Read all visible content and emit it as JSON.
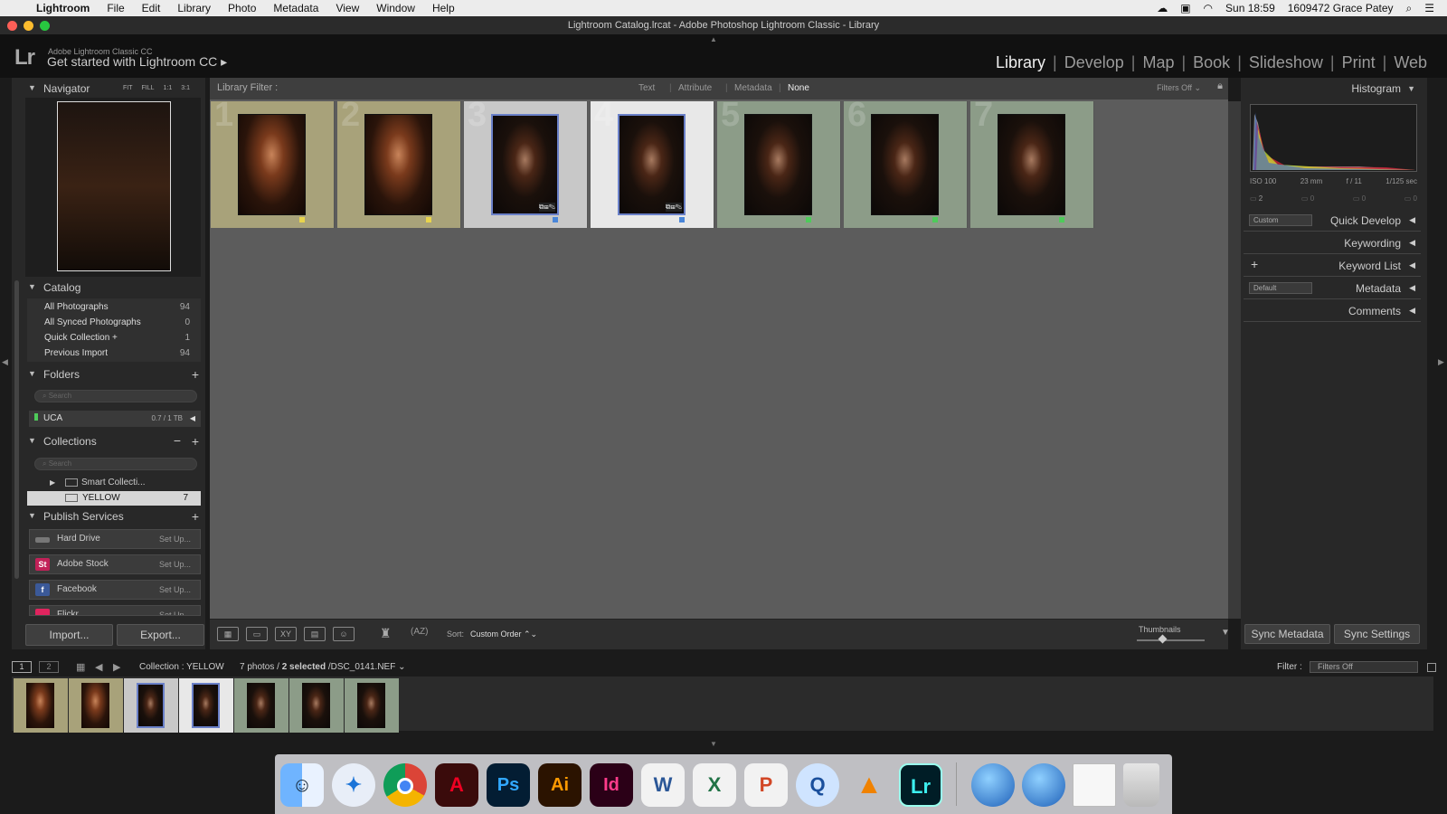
{
  "menubar": {
    "app": "Lightroom",
    "items": [
      "File",
      "Edit",
      "Library",
      "Photo",
      "Metadata",
      "View",
      "Window",
      "Help"
    ],
    "clock": "Sun 18:59",
    "user": "1609472 Grace Patey"
  },
  "window": {
    "title": "Lightroom Catalog.lrcat - Adobe Photoshop Lightroom Classic - Library"
  },
  "identity": {
    "logo": "Lr",
    "small": "Adobe Lightroom Classic CC",
    "big": "Get started with Lightroom CC"
  },
  "modules": [
    "Library",
    "Develop",
    "Map",
    "Book",
    "Slideshow",
    "Print",
    "Web"
  ],
  "navigator": {
    "title": "Navigator",
    "zoom": [
      "FIT",
      "FILL",
      "1:1",
      "3:1"
    ]
  },
  "catalog": {
    "title": "Catalog",
    "rows": [
      {
        "label": "All Photographs",
        "count": "94"
      },
      {
        "label": "All Synced Photographs",
        "count": "0"
      },
      {
        "label": "Quick Collection +",
        "count": "1"
      },
      {
        "label": "Previous Import",
        "count": "94"
      }
    ]
  },
  "folders": {
    "title": "Folders",
    "search": "Search",
    "volume": "UCA",
    "volume_size": "0.7 / 1 TB"
  },
  "collections": {
    "title": "Collections",
    "search": "Search",
    "smart": "Smart Collecti...",
    "yellow": "YELLOW",
    "yellow_count": "7"
  },
  "publish": {
    "title": "Publish Services",
    "rows": [
      {
        "label": "Hard Drive",
        "setup": "Set Up..."
      },
      {
        "label": "Adobe Stock",
        "setup": "Set Up..."
      },
      {
        "label": "Facebook",
        "setup": "Set Up..."
      },
      {
        "label": "Flickr",
        "setup": "Set Up..."
      }
    ]
  },
  "left_buttons": {
    "import": "Import...",
    "export": "Export..."
  },
  "filter": {
    "label": "Library Filter :",
    "tabs": [
      "Text",
      "Attribute",
      "Metadata",
      "None"
    ],
    "state": "Filters Off"
  },
  "grid": {
    "cells": [
      {
        "num": "1",
        "label_color": "#e8d44d",
        "bg": "#a8a27a",
        "selected": false
      },
      {
        "num": "2",
        "label_color": "#e8d44d",
        "bg": "#a8a27a",
        "selected": false
      },
      {
        "num": "3",
        "label_color": "#4a86d9",
        "bg": "#c8c8c8",
        "selected": true
      },
      {
        "num": "4",
        "label_color": "#4a86d9",
        "bg": "#e8e8e8",
        "selected": true
      },
      {
        "num": "5",
        "label_color": "#4ecb5a",
        "bg": "#8c9c88",
        "selected": false
      },
      {
        "num": "6",
        "label_color": "#4ecb5a",
        "bg": "#8c9c88",
        "selected": false
      },
      {
        "num": "7",
        "label_color": "#4ecb5a",
        "bg": "#8c9c88",
        "selected": false
      }
    ]
  },
  "toolbar": {
    "sort_label": "Sort:",
    "sort_value": "Custom Order",
    "thumbnails": "Thumbnails"
  },
  "histogram": {
    "title": "Histogram",
    "iso": "ISO 100",
    "focal": "23 mm",
    "aperture": "f / 11",
    "shutter": "1/125 sec",
    "count": "2"
  },
  "right_panels": {
    "quick_develop": "Quick Develop",
    "quick_develop_preset": "Custom",
    "keywording": "Keywording",
    "keyword_list": "Keyword List",
    "metadata": "Metadata",
    "metadata_preset": "Default",
    "comments": "Comments"
  },
  "right_buttons": {
    "sync_metadata": "Sync Metadata",
    "sync_settings": "Sync Settings"
  },
  "filmstrip": {
    "page1": "1",
    "page2": "2",
    "source": "Collection : YELLOW",
    "count_pre": "7 photos /",
    "selected": "2 selected",
    "file": "/DSC_0141.NEF",
    "filter_label": "Filter :",
    "filter_value": "Filters Off"
  },
  "dock": [
    "Finder",
    "Safari",
    "Chrome",
    "Acrobat",
    "Ps",
    "Ai",
    "Id",
    "Word",
    "Excel",
    "PowerPoint",
    "QuickTime",
    "VLC",
    "Lr",
    "Network",
    "Network",
    "Preview",
    "Trash"
  ]
}
